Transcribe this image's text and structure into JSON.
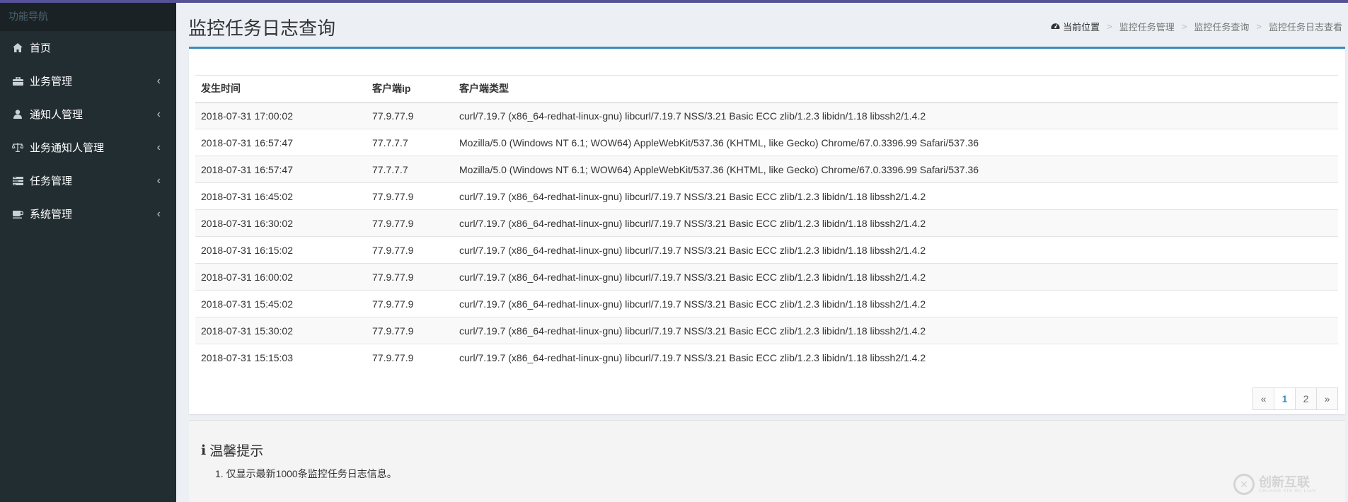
{
  "sidebar": {
    "header": "功能导航",
    "items": [
      {
        "label": "首页",
        "icon": "home-icon",
        "has_children": false
      },
      {
        "label": "业务管理",
        "icon": "briefcase-icon",
        "has_children": true
      },
      {
        "label": "通知人管理",
        "icon": "user-icon",
        "has_children": true
      },
      {
        "label": "业务通知人管理",
        "icon": "balance-scale-icon",
        "has_children": true
      },
      {
        "label": "任务管理",
        "icon": "tasks-icon",
        "has_children": true
      },
      {
        "label": "系统管理",
        "icon": "coffee-icon",
        "has_children": true
      }
    ],
    "chevron": "‹"
  },
  "header": {
    "title": "监控任务日志查询",
    "breadcrumb": {
      "home_label": "当前位置",
      "separator": ">",
      "items": [
        "监控任务管理",
        "监控任务查询",
        "监控任务日志查看"
      ]
    }
  },
  "table": {
    "columns": [
      "发生时间",
      "客户端ip",
      "客户端类型"
    ],
    "rows": [
      [
        "2018-07-31 17:00:02",
        "77.9.77.9",
        "curl/7.19.7 (x86_64-redhat-linux-gnu) libcurl/7.19.7 NSS/3.21 Basic ECC zlib/1.2.3 libidn/1.18 libssh2/1.4.2"
      ],
      [
        "2018-07-31 16:57:47",
        "77.7.7.7",
        "Mozilla/5.0 (Windows NT 6.1; WOW64) AppleWebKit/537.36 (KHTML, like Gecko) Chrome/67.0.3396.99 Safari/537.36"
      ],
      [
        "2018-07-31 16:57:47",
        "77.7.7.7",
        "Mozilla/5.0 (Windows NT 6.1; WOW64) AppleWebKit/537.36 (KHTML, like Gecko) Chrome/67.0.3396.99 Safari/537.36"
      ],
      [
        "2018-07-31 16:45:02",
        "77.9.77.9",
        "curl/7.19.7 (x86_64-redhat-linux-gnu) libcurl/7.19.7 NSS/3.21 Basic ECC zlib/1.2.3 libidn/1.18 libssh2/1.4.2"
      ],
      [
        "2018-07-31 16:30:02",
        "77.9.77.9",
        "curl/7.19.7 (x86_64-redhat-linux-gnu) libcurl/7.19.7 NSS/3.21 Basic ECC zlib/1.2.3 libidn/1.18 libssh2/1.4.2"
      ],
      [
        "2018-07-31 16:15:02",
        "77.9.77.9",
        "curl/7.19.7 (x86_64-redhat-linux-gnu) libcurl/7.19.7 NSS/3.21 Basic ECC zlib/1.2.3 libidn/1.18 libssh2/1.4.2"
      ],
      [
        "2018-07-31 16:00:02",
        "77.9.77.9",
        "curl/7.19.7 (x86_64-redhat-linux-gnu) libcurl/7.19.7 NSS/3.21 Basic ECC zlib/1.2.3 libidn/1.18 libssh2/1.4.2"
      ],
      [
        "2018-07-31 15:45:02",
        "77.9.77.9",
        "curl/7.19.7 (x86_64-redhat-linux-gnu) libcurl/7.19.7 NSS/3.21 Basic ECC zlib/1.2.3 libidn/1.18 libssh2/1.4.2"
      ],
      [
        "2018-07-31 15:30:02",
        "77.9.77.9",
        "curl/7.19.7 (x86_64-redhat-linux-gnu) libcurl/7.19.7 NSS/3.21 Basic ECC zlib/1.2.3 libidn/1.18 libssh2/1.4.2"
      ],
      [
        "2018-07-31 15:15:03",
        "77.9.77.9",
        "curl/7.19.7 (x86_64-redhat-linux-gnu) libcurl/7.19.7 NSS/3.21 Basic ECC zlib/1.2.3 libidn/1.18 libssh2/1.4.2"
      ]
    ]
  },
  "pagination": {
    "prev": "«",
    "pages": [
      "1",
      "2"
    ],
    "active": "1",
    "next": "»"
  },
  "tip": {
    "icon": "info-icon",
    "title": "温馨提示",
    "items": [
      "1. 仅显示最新1000条监控任务日志信息。"
    ]
  },
  "watermark": {
    "text": "创新互联",
    "sub": "CHUANG XIN HU LIAN"
  },
  "colors": {
    "sidebar_bg": "#222d32",
    "accent": "#3c8dbc",
    "top_bar": "#555299"
  }
}
